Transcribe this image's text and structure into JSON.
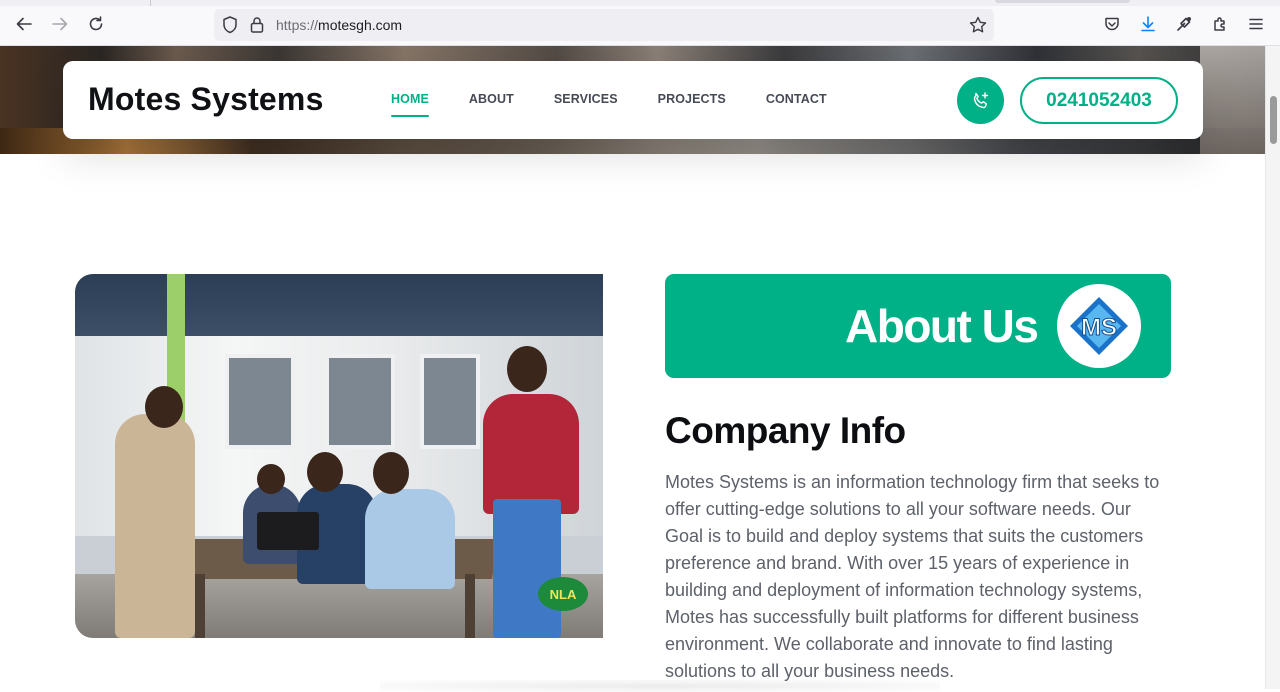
{
  "browser": {
    "url_scheme": "https://",
    "url_host": "motesgh.com"
  },
  "header": {
    "brand": "Motes Systems",
    "nav": [
      {
        "label": "HOME",
        "active": true
      },
      {
        "label": "ABOUT",
        "active": false
      },
      {
        "label": "SERVICES",
        "active": false
      },
      {
        "label": "PROJECTS",
        "active": false
      },
      {
        "label": "CONTACT",
        "active": false
      }
    ],
    "phone": "0241052403"
  },
  "photo": {
    "badge_text": "NLA"
  },
  "about": {
    "banner_title": "About Us",
    "logo_text": "MS",
    "company_title": "Company Info",
    "company_text": "Motes Systems is an information technology firm that seeks to offer cutting-edge solutions to all your software needs. Our Goal is to build and deploy systems that suits the customers preference and brand. With over 15 years of experience in building and deployment of information technology systems, Motes has successfully built platforms for different business environment. We collaborate and innovate to find lasting solutions to all your business needs."
  },
  "colors": {
    "accent": "#00b087",
    "heading": "#0d0e12",
    "body_text": "#5d616a"
  }
}
